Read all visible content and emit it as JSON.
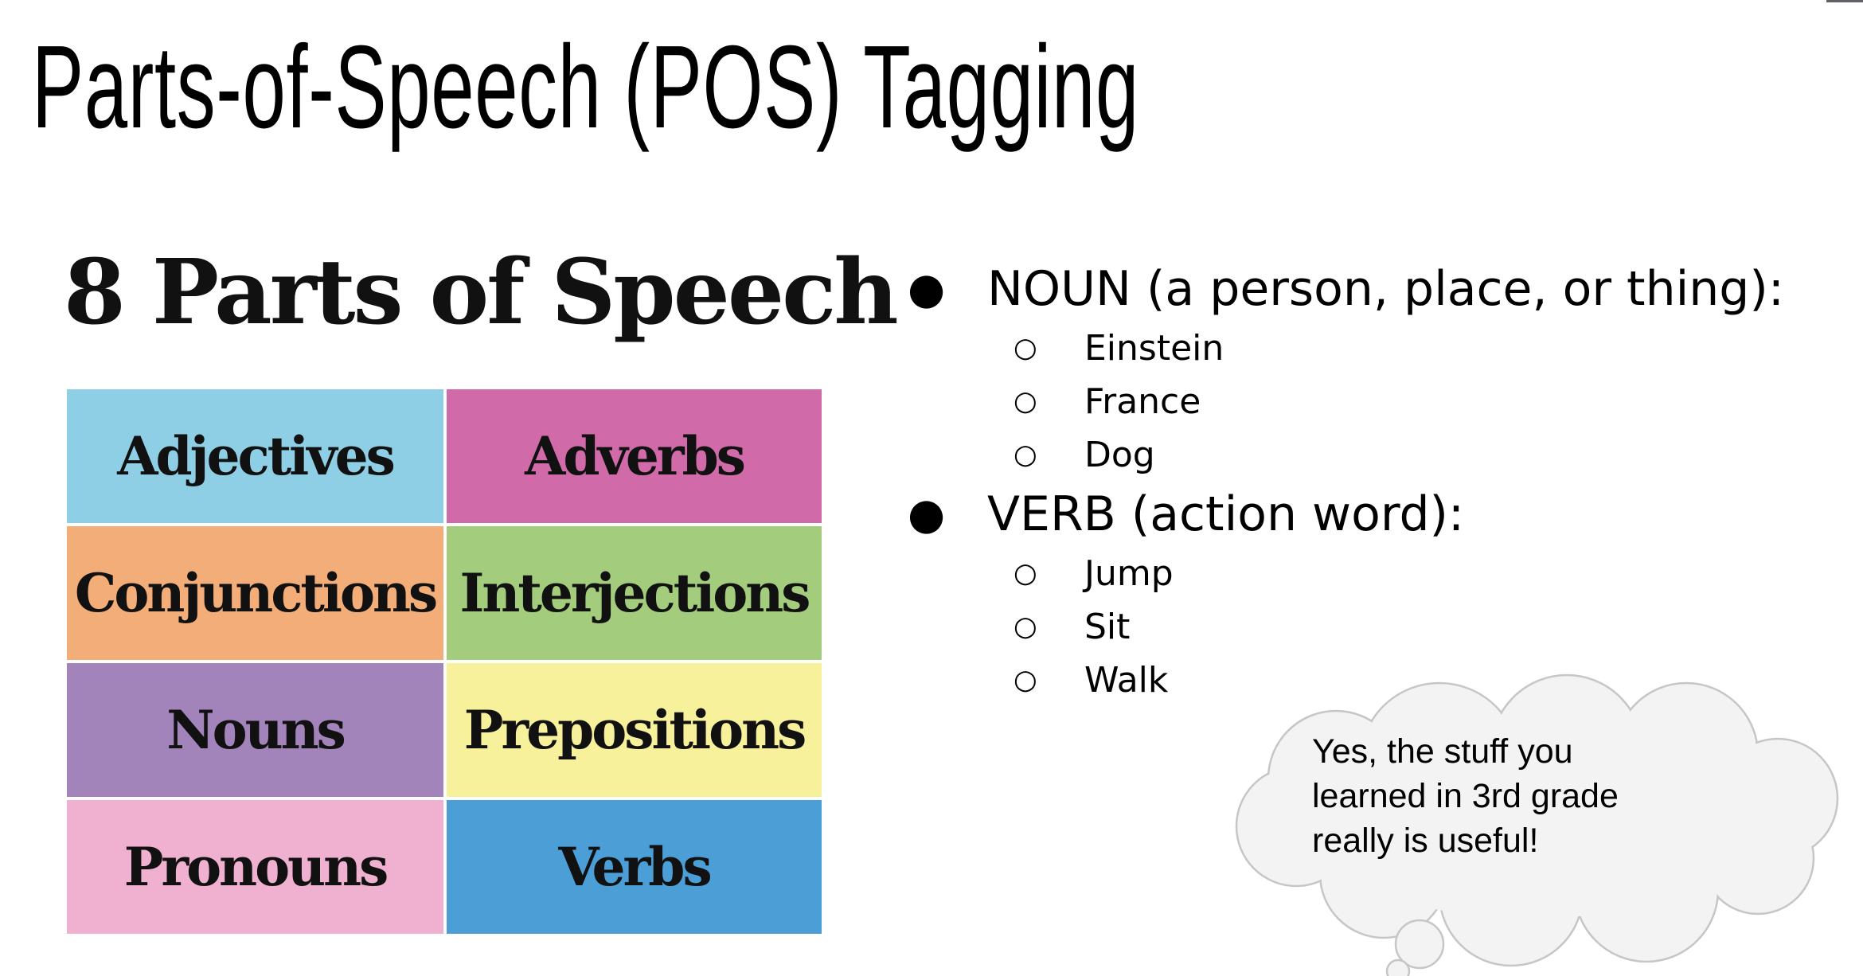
{
  "slide": {
    "title": "Parts-of-Speech (POS) Tagging"
  },
  "image": {
    "title": "8 Parts of Speech",
    "cells": [
      {
        "label": "Adjectives",
        "color": "#8fcfe6"
      },
      {
        "label": "Adverbs",
        "color": "#d06aa8"
      },
      {
        "label": "Conjunctions",
        "color": "#f2ad78"
      },
      {
        "label": "Interjections",
        "color": "#a3cd7c"
      },
      {
        "label": "Nouns",
        "color": "#a284bb"
      },
      {
        "label": "Prepositions",
        "color": "#f7f19c"
      },
      {
        "label": "Pronouns",
        "color": "#f0b0cf"
      },
      {
        "label": "Verbs",
        "color": "#4c9ed6"
      }
    ]
  },
  "bullets": [
    {
      "text": "NOUN (a person, place, or thing):",
      "items": [
        "Einstein",
        "France",
        "Dog"
      ]
    },
    {
      "text": "VERB (action word):",
      "items": [
        "Jump",
        "Sit",
        "Walk"
      ]
    }
  ],
  "callout": {
    "lines": [
      "Yes, the stuff you",
      "learned in 3rd grade",
      "really is useful!"
    ]
  }
}
